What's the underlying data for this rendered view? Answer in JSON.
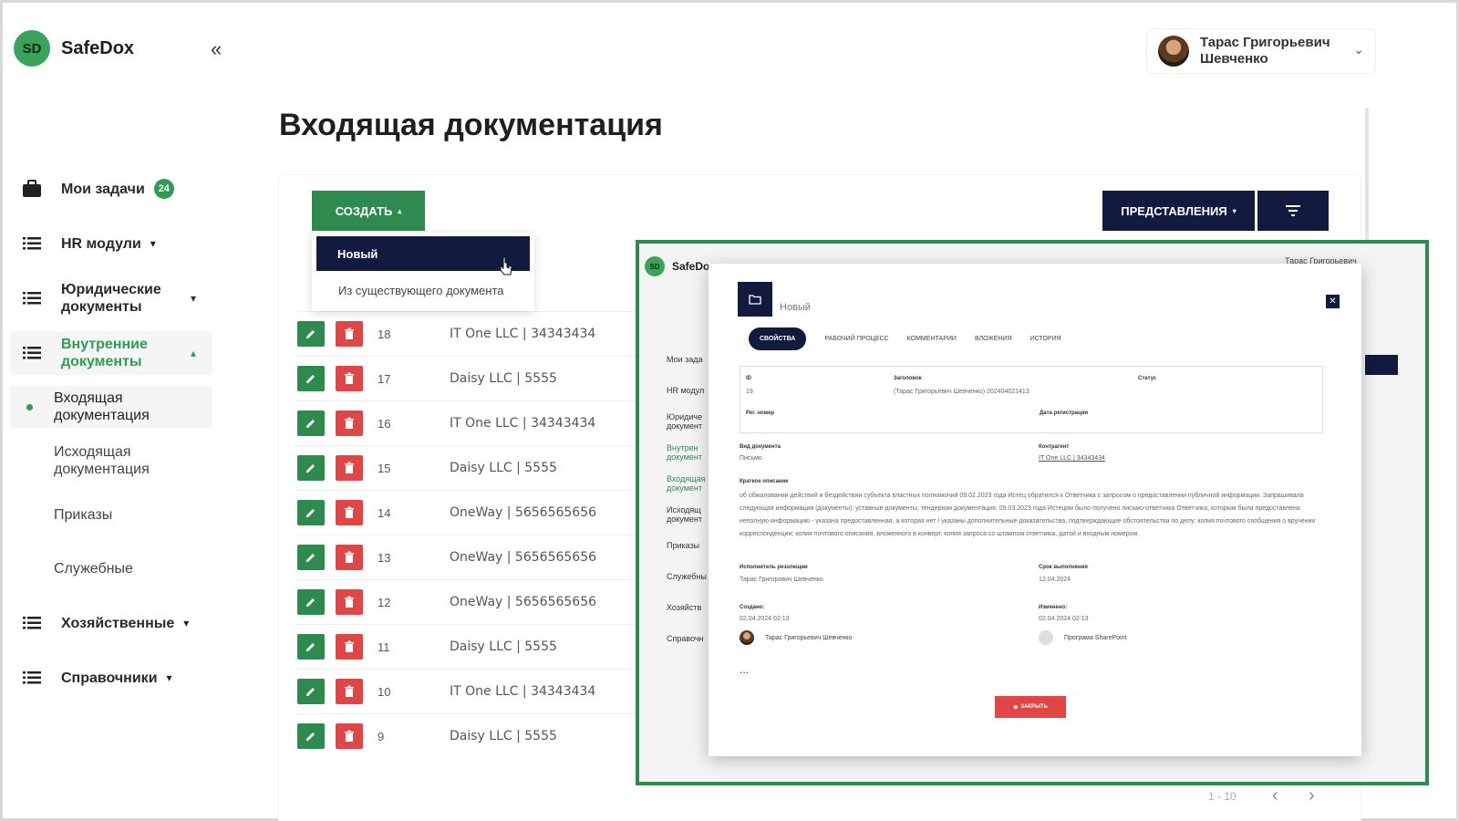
{
  "app": {
    "logo_initials": "SD",
    "name": "SafeDox",
    "collapse_icon": "«"
  },
  "user": {
    "name_line1": "Тарас Григорьевич",
    "name_line2": "Шевченко"
  },
  "page_title": "Входящая документация",
  "sidebar": {
    "tasks": {
      "label": "Мои задачи",
      "badge": "24"
    },
    "hr": {
      "label": "HR модули"
    },
    "legal": {
      "label_line1": "Юридические",
      "label_line2": "документы"
    },
    "internal": {
      "label_line1": "Внутренние",
      "label_line2": "документы"
    },
    "sub_incoming": {
      "line1": "Входящая",
      "line2": "документация"
    },
    "sub_outgoing": {
      "line1": "Исходящая",
      "line2": "документация"
    },
    "sub_orders": "Приказы",
    "sub_service": "Служебные",
    "economic": {
      "label": "Хозяйственные"
    },
    "references": {
      "label": "Справочники"
    }
  },
  "toolbar": {
    "create_label": "СОЗДАТЬ",
    "views_label": "ПРЕДСТАВЛЕНИЯ"
  },
  "create_menu": {
    "new": "Новый",
    "from_existing": "Из существующего документа"
  },
  "rows": [
    {
      "num": "18",
      "party": "IT One LLC | 34343434"
    },
    {
      "num": "17",
      "party": "Daisy LLC | 5555"
    },
    {
      "num": "16",
      "party": "IT One LLC | 34343434"
    },
    {
      "num": "15",
      "party": "Daisy LLC | 5555"
    },
    {
      "num": "14",
      "party": "OneWay | 5656565656"
    },
    {
      "num": "13",
      "party": "OneWay | 5656565656"
    },
    {
      "num": "12",
      "party": "OneWay | 5656565656"
    },
    {
      "num": "11",
      "party": "Daisy LLC | 5555"
    },
    {
      "num": "10",
      "party": "IT One LLC | 34343434"
    },
    {
      "num": "9",
      "party": "Daisy LLC | 5555"
    }
  ],
  "pager": {
    "info": "1 - 10"
  },
  "inset": {
    "app_name": "SafeDo",
    "logo_initials": "SD",
    "user_short": "Тарас Григорьевич",
    "nav": [
      "Мои зада",
      "HR модул",
      "Юридиче документ",
      "Внутрен документ",
      "Входящая документ",
      "Исходящ документ",
      "Приказы",
      "Служебны",
      "Хозяйств",
      "Справочн"
    ],
    "modal": {
      "title": "Новый",
      "tabs": [
        "Свойства",
        "Рабочий процесс",
        "Комментарии",
        "Вложения",
        "История"
      ],
      "id_label": "ID",
      "id_value": "19",
      "heading_label": "Заголовок",
      "heading_value": "(Тарас Григорьевич Шевченко) 202404021413",
      "status_label": "Статус",
      "reg_label": "Рег. номер",
      "regdate_label": "Дата регистрации",
      "doctype_label": "Вид документа",
      "doctype_value": "Письмо",
      "contractor_label": "Контрагент",
      "contractor_value": "IT One LLC | 34343434",
      "desc_label": "Краткое описание",
      "desc_value": "об обжаловании действий и бездействии субъекта властных полномочий 09.02.2023 года Истец обратился к Ответчика с запросом о предоставлении публичной информации. Запрашивала следующая информация (документы): уставные документы, тендерная документация. 09.03.2023 года Истецом было получено письмо-ответчика Ответчика, которым была предоставлена неполную информацию - указана предоставленная, а которая нет / указаны дополнительные доказательства, подтверждающие обстоятельства по делу: копия почтового сообщения о вручении корреспонденции; копия почтового описания, вложенного в конверт, копия запроса со штампом ответчика, датой и входным номером.",
      "executor_label": "Исполнитель резолюции",
      "executor_value": "Тарас Григорович Шевченко",
      "deadline_label": "Срок выполнения",
      "deadline_value": "12.04.2024",
      "created_label": "Создано:",
      "created_value": "02.04.2024 02:13",
      "created_by": "Тарас Григорьевич Шевченко",
      "modified_label": "Изменено:",
      "modified_value": "02.04.2024 02:13",
      "modified_by": "Програма SharePoint",
      "ellipsis": "...",
      "close_label": "ЗАКРЫТЬ"
    }
  }
}
